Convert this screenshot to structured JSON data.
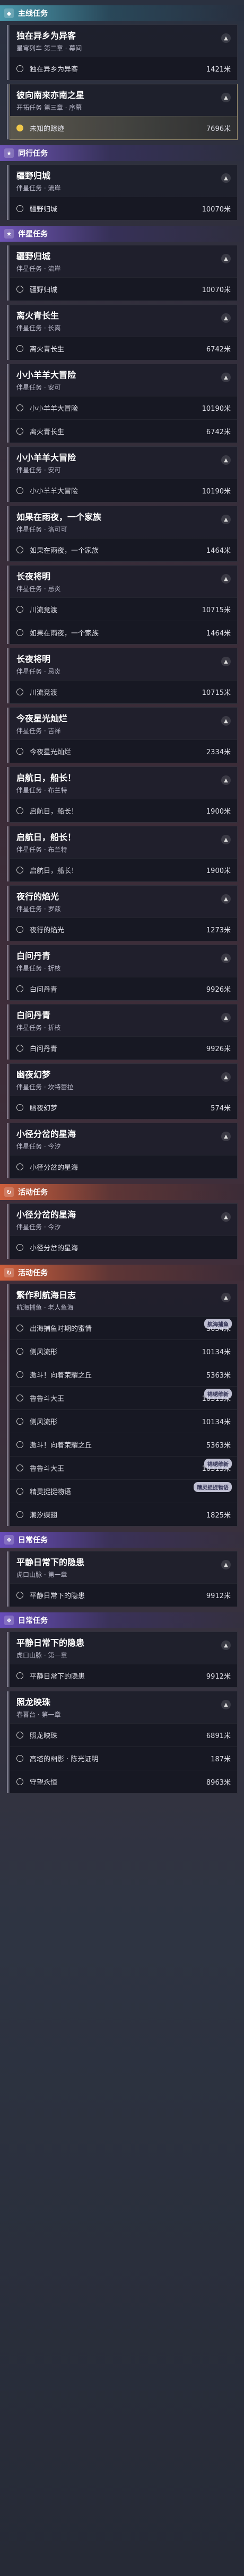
{
  "sections": [
    {
      "type": "header",
      "style": "teal",
      "icon": "diamond-icon",
      "label": "主线任务"
    },
    {
      "type": "card",
      "title": "独在异乡为异客",
      "subtitle": "星穹列车 第二章 · 幕间",
      "subs": [
        {
          "name": "独在异乡为异客",
          "dist": "1421米"
        }
      ]
    },
    {
      "type": "card",
      "active": true,
      "title": "彼向南来亦南之星",
      "subtitle": "开拓任务 第三章 · 序幕",
      "subs": [
        {
          "name": "未知的踪迹",
          "dist": "7696米",
          "highlight": true
        }
      ]
    },
    {
      "type": "header",
      "style": "purple",
      "icon": "star-icon",
      "label": "同行任务"
    },
    {
      "type": "card",
      "title": "疆野归城",
      "subtitle": "伴星任务 · 流岸",
      "subs": [
        {
          "name": "疆野归城",
          "dist": "10070米"
        }
      ]
    },
    {
      "type": "header",
      "style": "purple",
      "icon": "star-icon",
      "label": "伴星任务"
    },
    {
      "type": "card",
      "title": "疆野归城",
      "subtitle": "伴星任务 · 流岸",
      "subs": [
        {
          "name": "疆野归城",
          "dist": "10070米"
        }
      ]
    },
    {
      "type": "card",
      "title": "离火青长生",
      "subtitle": "伴星任务 · 长离",
      "subs": [
        {
          "name": "离火青长生",
          "dist": "6742米"
        }
      ]
    },
    {
      "type": "card",
      "title": "小小羊羊大冒险",
      "subtitle": "伴星任务 · 安可",
      "subs": [
        {
          "name": "小小羊羊大冒险",
          "dist": "10190米"
        },
        {
          "name": "离火青长生",
          "dist": "6742米"
        }
      ]
    },
    {
      "type": "card",
      "title": "小小羊羊大冒险",
      "subtitle": "伴星任务 · 安可",
      "subs": [
        {
          "name": "小小羊羊大冒险",
          "dist": "10190米"
        }
      ]
    },
    {
      "type": "card",
      "title": "如果在雨夜，一个家族",
      "subtitle": "伴星任务 · 洛可可",
      "subs": [
        {
          "name": "如果在雨夜，一个家族",
          "dist": "1464米"
        }
      ]
    },
    {
      "type": "card",
      "title": "长夜将明",
      "subtitle": "伴星任务 · 忌炎",
      "subs": [
        {
          "name": "川流竞渡",
          "dist": "10715米"
        },
        {
          "name": "如果在雨夜，一个家族",
          "dist": "1464米"
        }
      ]
    },
    {
      "type": "card",
      "title": "长夜将明",
      "subtitle": "伴星任务 · 忌炎",
      "subs": [
        {
          "name": "川流竞渡",
          "dist": "10715米"
        }
      ]
    },
    {
      "type": "card",
      "title": "今夜星光灿烂",
      "subtitle": "伴星任务 · 吉祥",
      "subs": [
        {
          "name": "今夜星光灿烂",
          "dist": "2334米"
        }
      ]
    },
    {
      "type": "card",
      "title": "启航日，船长！",
      "subtitle": "伴星任务 · 布兰特",
      "subs": [
        {
          "name": "启航日，船长！",
          "dist": "1900米"
        }
      ]
    },
    {
      "type": "card",
      "title": "启航日，船长！",
      "subtitle": "伴星任务 · 布兰特",
      "subs": [
        {
          "name": "启航日，船长！",
          "dist": "1900米"
        }
      ]
    },
    {
      "type": "card",
      "title": "夜行的焰光",
      "subtitle": "伴星任务 · 罗兹",
      "subs": [
        {
          "name": "夜行的焰光",
          "dist": "1273米"
        }
      ]
    },
    {
      "type": "card",
      "title": "白问丹青",
      "subtitle": "伴星任务 · 折枝",
      "subs": [
        {
          "name": "白问丹青",
          "dist": "9926米"
        }
      ]
    },
    {
      "type": "card",
      "title": "白问丹青",
      "subtitle": "伴星任务 · 折枝",
      "subs": [
        {
          "name": "白问丹青",
          "dist": "9926米"
        }
      ]
    },
    {
      "type": "card",
      "title": "幽夜幻梦",
      "subtitle": "伴星任务 · 坎特蕾拉",
      "subs": [
        {
          "name": "幽夜幻梦",
          "dist": "574米"
        }
      ]
    },
    {
      "type": "card",
      "title": "小径分岔的星海",
      "subtitle": "伴星任务 · 今汐",
      "subs": [
        {
          "name": "小径分岔的星海",
          "dist": ""
        }
      ]
    },
    {
      "type": "header",
      "style": "orange",
      "icon": "refresh-icon",
      "label": "活动任务"
    },
    {
      "type": "card",
      "title": "小径分岔的星海",
      "subtitle": "伴星任务 · 今汐",
      "subs": [
        {
          "name": "小径分岔的星海",
          "dist": ""
        }
      ]
    },
    {
      "type": "header",
      "style": "orange",
      "icon": "refresh-icon",
      "label": "活动任务"
    },
    {
      "type": "card",
      "title": "繁作利航海日志",
      "subtitle": "航海捕鱼 · 老人鱼海",
      "subs": [
        {
          "name": "出海捕鱼时期的蜜情",
          "dist": "3054米",
          "badge": "航海捕鱼"
        },
        {
          "name": "侧风流形",
          "dist": "10134米"
        },
        {
          "name": "激斗！向着荣耀之丘",
          "dist": "5363米"
        },
        {
          "name": "鲁鲁斗大王",
          "dist": "10313米",
          "badge": "锦绣维新"
        },
        {
          "name": "侧风流形",
          "dist": "10134米"
        },
        {
          "name": "激斗！向着荣耀之丘",
          "dist": "5363米"
        },
        {
          "name": "鲁鲁斗大王",
          "dist": "10313米",
          "badge": "锦绣维新"
        },
        {
          "name": "精灵捉捉物语",
          "dist": "",
          "badge": "精灵捉捉物语"
        },
        {
          "name": "潮汐蝶翅",
          "dist": "1825米"
        }
      ]
    },
    {
      "type": "header",
      "style": "purple2",
      "icon": "leaf-icon",
      "label": "日常任务"
    },
    {
      "type": "card",
      "title": "平静日常下的隐患",
      "subtitle": "虎口山脉 · 第一章",
      "subs": [
        {
          "name": "平静日常下的隐患",
          "dist": "9912米"
        }
      ]
    },
    {
      "type": "header",
      "style": "purple2",
      "icon": "leaf-icon",
      "label": "日常任务"
    },
    {
      "type": "card",
      "title": "平静日常下的隐患",
      "subtitle": "虎口山脉 · 第一章",
      "subs": [
        {
          "name": "平静日常下的隐患",
          "dist": "9912米"
        }
      ]
    },
    {
      "type": "card",
      "title": "照龙映珠",
      "subtitle": "春暮台 · 第一章",
      "subs": [
        {
          "name": "照龙映珠",
          "dist": "6891米"
        },
        {
          "name": "高塔的幽影 · 陈光证明",
          "dist": "187米"
        },
        {
          "name": "守望永恒",
          "dist": "8963米"
        }
      ]
    }
  ]
}
